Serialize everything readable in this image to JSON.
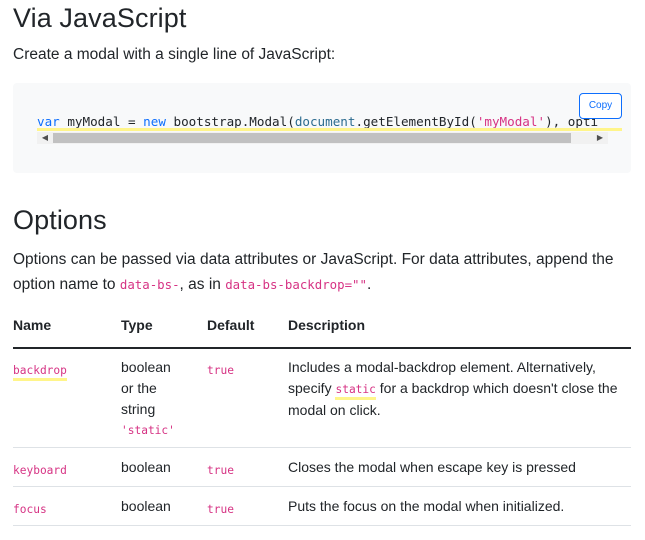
{
  "section_js": {
    "heading": "Via JavaScript",
    "description": "Create a modal with a single line of JavaScript:",
    "code": {
      "tokens": [
        {
          "text": "var",
          "cls": "kw"
        },
        {
          "text": " myModal = ",
          "cls": "fn"
        },
        {
          "text": "new",
          "cls": "kw"
        },
        {
          "text": " bootstrap.Modal(",
          "cls": "fn"
        },
        {
          "text": "document",
          "cls": "prop"
        },
        {
          "text": ".getElementById(",
          "cls": "fn"
        },
        {
          "text": "'myModal'",
          "cls": "str"
        },
        {
          "text": "), opti",
          "cls": "fn"
        }
      ],
      "copy_label": "Copy",
      "scroll_left": "◀",
      "scroll_right": "▶"
    }
  },
  "section_options": {
    "heading": "Options",
    "desc_part1": "Options can be passed via data attributes or JavaScript. For data attributes, append the option name to ",
    "desc_code1": "data-bs-",
    "desc_part2": ", as in ",
    "desc_code2": "data-bs-backdrop=\"\"",
    "desc_part3": ".",
    "table": {
      "headers": [
        "Name",
        "Type",
        "Default",
        "Description"
      ],
      "rows": [
        {
          "name": "backdrop",
          "type_lines": [
            "boolean",
            "or the",
            "string"
          ],
          "type_code": "'static'",
          "default": "true",
          "desc_a": "Includes a modal-backdrop element. Alternatively, specify ",
          "desc_code": "static",
          "desc_b": " for a backdrop which doesn't close the modal on click."
        },
        {
          "name": "keyboard",
          "type": "boolean",
          "default": "true",
          "desc": "Closes the modal when escape key is pressed"
        },
        {
          "name": "focus",
          "type": "boolean",
          "default": "true",
          "desc": "Puts the focus on the modal when initialized."
        }
      ]
    }
  }
}
